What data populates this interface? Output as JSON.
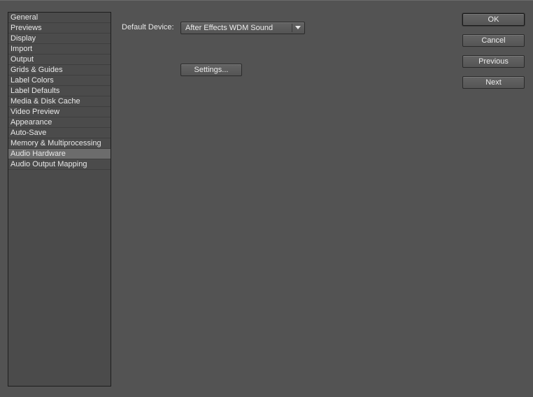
{
  "sidebar": {
    "items": [
      {
        "label": "General"
      },
      {
        "label": "Previews"
      },
      {
        "label": "Display"
      },
      {
        "label": "Import"
      },
      {
        "label": "Output"
      },
      {
        "label": "Grids & Guides"
      },
      {
        "label": "Label Colors"
      },
      {
        "label": "Label Defaults"
      },
      {
        "label": "Media & Disk Cache"
      },
      {
        "label": "Video Preview"
      },
      {
        "label": "Appearance"
      },
      {
        "label": "Auto-Save"
      },
      {
        "label": "Memory & Multiprocessing"
      },
      {
        "label": "Audio Hardware"
      },
      {
        "label": "Audio Output Mapping"
      }
    ],
    "selected_index": 13
  },
  "main": {
    "default_device_label": "Default Device:",
    "default_device_value": "After Effects WDM Sound",
    "dropdown_icon": "triangle-down-icon",
    "settings_label": "Settings..."
  },
  "actions": {
    "ok_label": "OK",
    "cancel_label": "Cancel",
    "previous_label": "Previous",
    "next_label": "Next"
  },
  "colors": {
    "background": "#535353",
    "sidebar_background": "#4b4b4b",
    "selected_item": "#6c6c6c",
    "text": "#e8e8e8"
  }
}
